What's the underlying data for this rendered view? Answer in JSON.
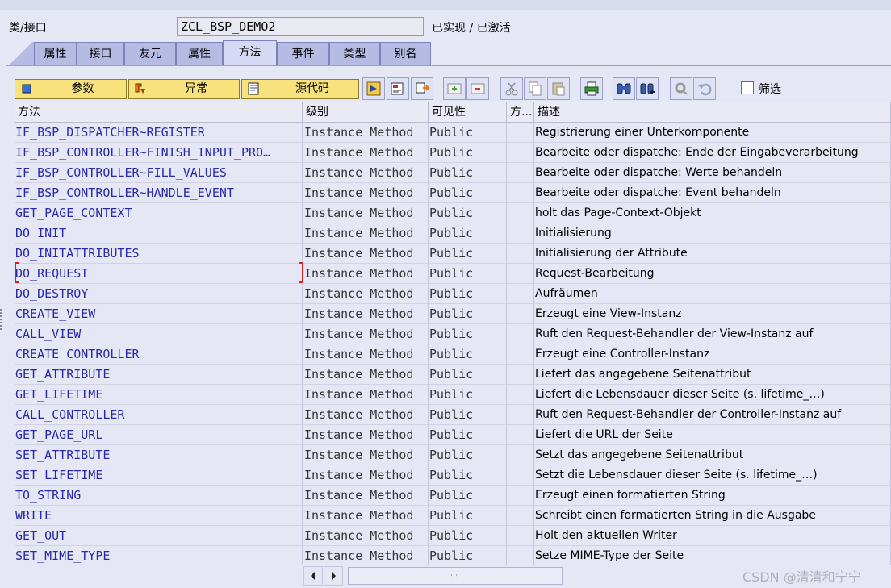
{
  "header": {
    "class_label": "类/接口",
    "class_value": "ZCL_BSP_DEMO2",
    "status": "已实现 / 已激活"
  },
  "tabs": [
    {
      "label": "属性",
      "active": false
    },
    {
      "label": "接口",
      "active": false
    },
    {
      "label": "友元",
      "active": false
    },
    {
      "label": "属性",
      "active": false
    },
    {
      "label": "方法",
      "active": true
    },
    {
      "label": "事件",
      "active": false
    },
    {
      "label": "类型",
      "active": false
    },
    {
      "label": "别名",
      "active": false
    }
  ],
  "toolbar": {
    "params_label": "参数",
    "exceptions_label": "异常",
    "source_label": "源代码",
    "filter_label": "筛选",
    "filter_checked": false,
    "icons": [
      "navigate-icon",
      "detail-view-icon",
      "redefine-icon",
      "insert-row-icon",
      "delete-row-icon",
      "cut-icon",
      "copy-icon",
      "paste-icon",
      "print-icon",
      "find-icon",
      "find-next-icon",
      "settings-icon",
      "undo-icon"
    ]
  },
  "table": {
    "columns": [
      "方法",
      "级别",
      "可见性",
      "方...",
      "描述"
    ],
    "rows": [
      {
        "name": "IF_BSP_DISPATCHER~REGISTER",
        "level": "Instance Method",
        "visibility": "Public",
        "desc": "Registrierung einer Unterkomponente"
      },
      {
        "name": "IF_BSP_CONTROLLER~FINISH_INPUT_PRO…",
        "level": "Instance Method",
        "visibility": "Public",
        "desc": "Bearbeite oder dispatche: Ende der Eingabeverarbeitung"
      },
      {
        "name": "IF_BSP_CONTROLLER~FILL_VALUES",
        "level": "Instance Method",
        "visibility": "Public",
        "desc": "Bearbeite oder dispatche: Werte behandeln"
      },
      {
        "name": "IF_BSP_CONTROLLER~HANDLE_EVENT",
        "level": "Instance Method",
        "visibility": "Public",
        "desc": "Bearbeite oder dispatche: Event behandeln"
      },
      {
        "name": "GET_PAGE_CONTEXT",
        "level": "Instance Method",
        "visibility": "Public",
        "desc": "holt das Page-Context-Objekt"
      },
      {
        "name": "DO_INIT",
        "level": "Instance Method",
        "visibility": "Public",
        "desc": "Initialisierung"
      },
      {
        "name": "DO_INITATTRIBUTES",
        "level": "Instance Method",
        "visibility": "Public",
        "desc": "Initialisierung der Attribute"
      },
      {
        "name": "DO_REQUEST",
        "level": "Instance Method",
        "visibility": "Public",
        "desc": "Request-Bearbeitung"
      },
      {
        "name": "DO_DESTROY",
        "level": "Instance Method",
        "visibility": "Public",
        "desc": "Aufräumen"
      },
      {
        "name": "CREATE_VIEW",
        "level": "Instance Method",
        "visibility": "Public",
        "desc": "Erzeugt eine View-Instanz"
      },
      {
        "name": "CALL_VIEW",
        "level": "Instance Method",
        "visibility": "Public",
        "desc": "Ruft den Request-Behandler der View-Instanz auf"
      },
      {
        "name": "CREATE_CONTROLLER",
        "level": "Instance Method",
        "visibility": "Public",
        "desc": "Erzeugt eine Controller-Instanz"
      },
      {
        "name": "GET_ATTRIBUTE",
        "level": "Instance Method",
        "visibility": "Public",
        "desc": "Liefert das angegebene Seitenattribut"
      },
      {
        "name": "GET_LIFETIME",
        "level": "Instance Method",
        "visibility": "Public",
        "desc": "Liefert die Lebensdauer dieser Seite (s. lifetime_…)"
      },
      {
        "name": "CALL_CONTROLLER",
        "level": "Instance Method",
        "visibility": "Public",
        "desc": "Ruft den Request-Behandler der Controller-Instanz auf"
      },
      {
        "name": "GET_PAGE_URL",
        "level": "Instance Method",
        "visibility": "Public",
        "desc": "Liefert die URL der Seite"
      },
      {
        "name": "SET_ATTRIBUTE",
        "level": "Instance Method",
        "visibility": "Public",
        "desc": "Setzt das angegebene Seitenattribut"
      },
      {
        "name": "SET_LIFETIME",
        "level": "Instance Method",
        "visibility": "Public",
        "desc": "Setzt die Lebensdauer dieser Seite (s. lifetime_…)"
      },
      {
        "name": "TO_STRING",
        "level": "Instance Method",
        "visibility": "Public",
        "desc": "Erzeugt einen formatierten String"
      },
      {
        "name": "WRITE",
        "level": "Instance Method",
        "visibility": "Public",
        "desc": "Schreibt einen formatierten String in die Ausgabe"
      },
      {
        "name": "GET_OUT",
        "level": "Instance Method",
        "visibility": "Public",
        "desc": "Holt den aktuellen Writer"
      },
      {
        "name": "SET_MIME_TYPE",
        "level": "Instance Method",
        "visibility": "Public",
        "desc": "Setze MIME-Type der Seite"
      }
    ],
    "focused_row": 7
  },
  "scroll": {
    "grip": ":::"
  },
  "watermark": "CSDN @清清和宁宁"
}
